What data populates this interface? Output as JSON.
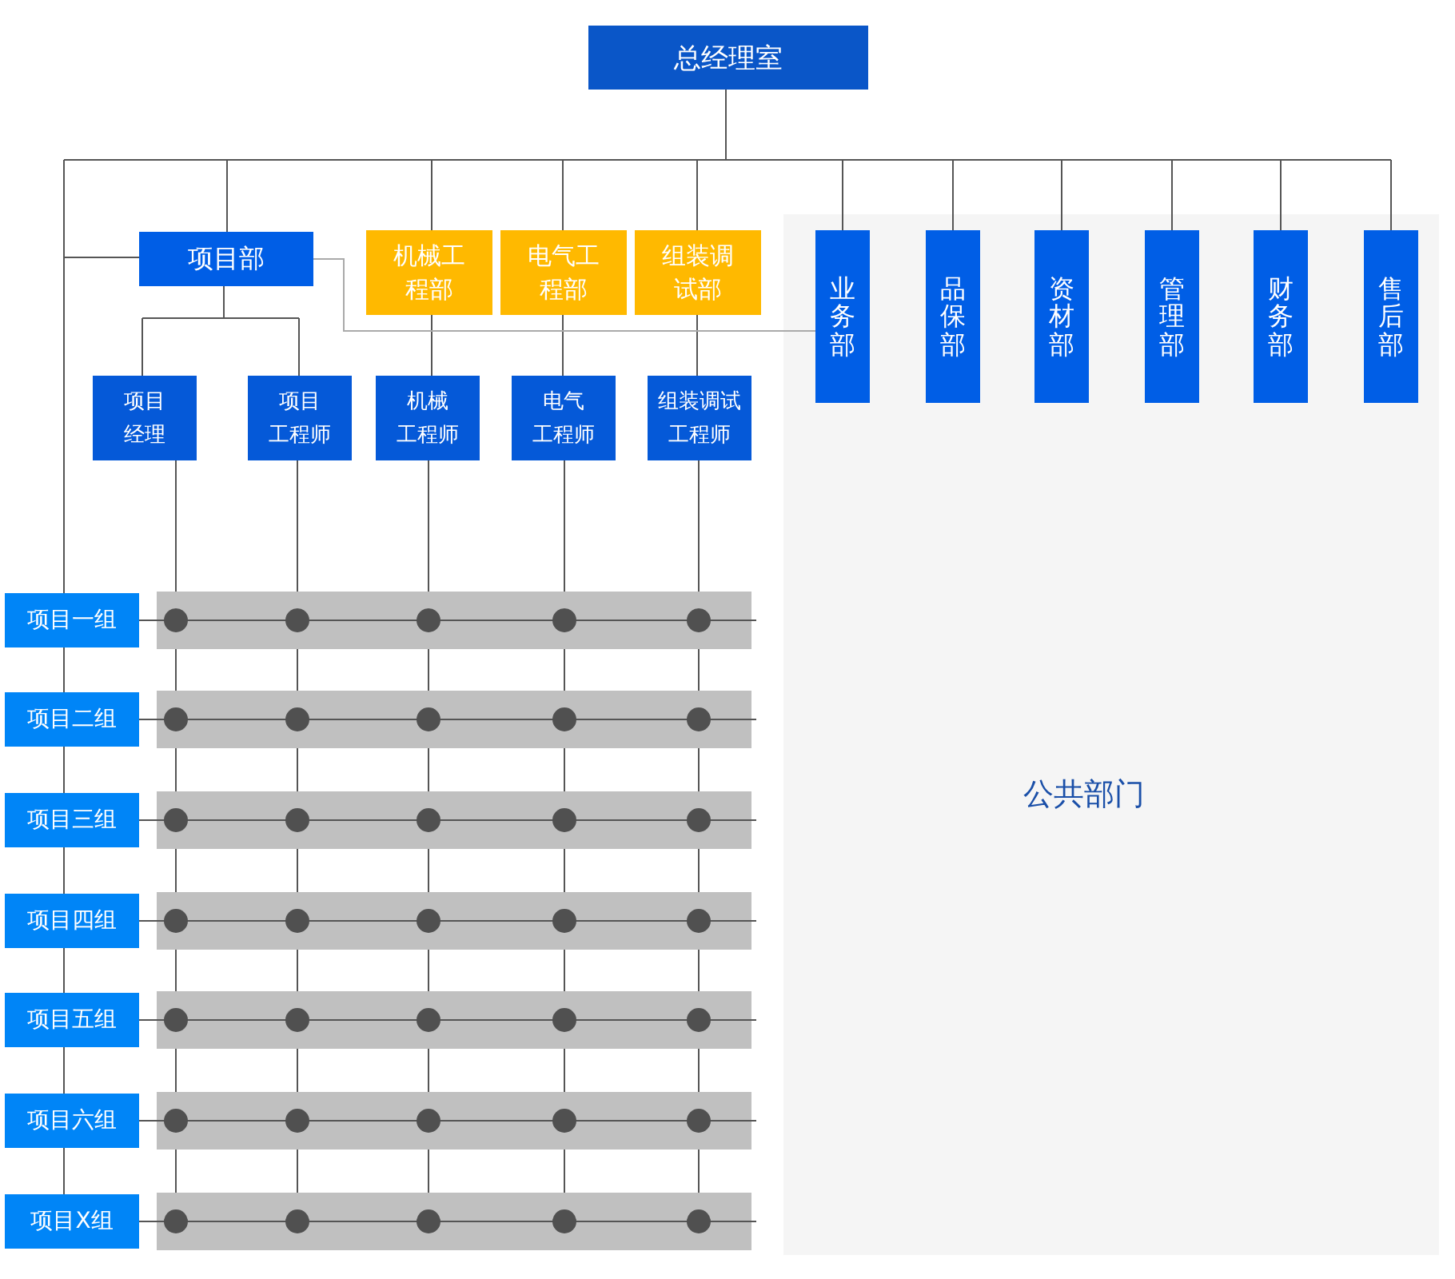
{
  "root": {
    "label": "总经理室"
  },
  "project_dept": {
    "label": "项目部"
  },
  "engineering_depts": [
    {
      "lines": [
        "机械工",
        "程部"
      ]
    },
    {
      "lines": [
        "电气工",
        "程部"
      ]
    },
    {
      "lines": [
        "组装调",
        "试部"
      ]
    }
  ],
  "roles": [
    {
      "lines": [
        "项目",
        "经理"
      ]
    },
    {
      "lines": [
        "项目",
        "工程师"
      ]
    },
    {
      "lines": [
        "机械",
        "工程师"
      ]
    },
    {
      "lines": [
        "电气",
        "工程师"
      ]
    },
    {
      "lines": [
        "组装调试",
        "工程师"
      ]
    }
  ],
  "public_area": {
    "label": "公共部门",
    "depts": [
      "业务部",
      "品保部",
      "资材部",
      "管理部",
      "财务部",
      "售后部"
    ]
  },
  "groups": [
    "项目一组",
    "项目二组",
    "项目三组",
    "项目四组",
    "项目五组",
    "项目六组",
    "项目X组"
  ]
}
